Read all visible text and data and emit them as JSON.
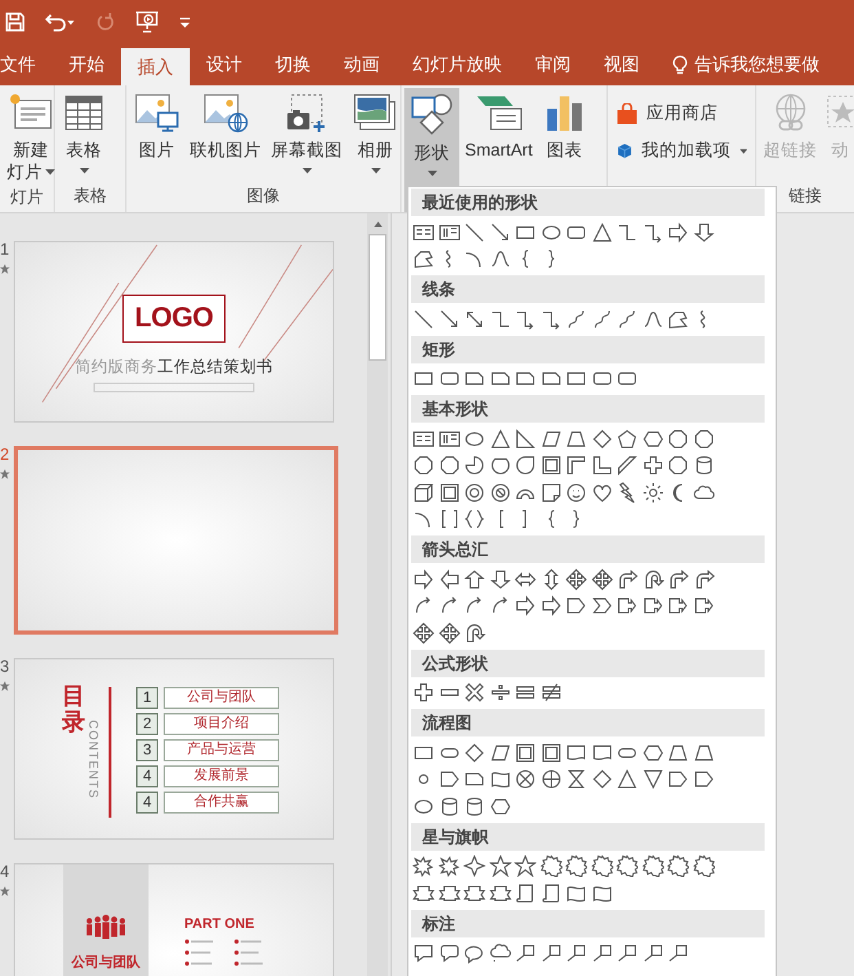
{
  "quick_access": [
    {
      "kind": "save",
      "disabled": false
    },
    {
      "kind": "undo",
      "disabled": false
    },
    {
      "kind": "redo",
      "disabled": true
    },
    {
      "kind": "present",
      "disabled": false
    },
    {
      "kind": "customize",
      "disabled": false
    }
  ],
  "tabs": [
    {
      "label": "文件",
      "selected": false
    },
    {
      "label": "开始",
      "selected": false
    },
    {
      "label": "插入",
      "selected": true
    },
    {
      "label": "设计",
      "selected": false
    },
    {
      "label": "切换",
      "selected": false
    },
    {
      "label": "动画",
      "selected": false
    },
    {
      "label": "幻灯片放映",
      "selected": false
    },
    {
      "label": "审阅",
      "selected": false
    },
    {
      "label": "视图",
      "selected": false
    }
  ],
  "tell_me": "告诉我您想要做",
  "ribbon": {
    "groups": [
      {
        "label": "灯片",
        "buttons": [
          {
            "kind": "new-slide",
            "label": "新建",
            "label_2": "灯片",
            "has_menu": true,
            "pressed": false,
            "disabled": false
          }
        ]
      },
      {
        "label": "表格",
        "buttons": [
          {
            "kind": "table",
            "label": "表格",
            "has_menu": true,
            "pressed": false,
            "disabled": false
          }
        ]
      },
      {
        "label": "图像",
        "buttons": [
          {
            "kind": "picture",
            "label": "图片",
            "has_menu": false,
            "pressed": false,
            "disabled": false
          },
          {
            "kind": "online-picture",
            "label": "联机图片",
            "has_menu": false,
            "pressed": false,
            "disabled": false
          },
          {
            "kind": "screenshot",
            "label": "屏幕截图",
            "has_menu": true,
            "pressed": false,
            "disabled": false
          },
          {
            "kind": "album",
            "label": "相册",
            "has_menu": true,
            "pressed": false,
            "disabled": false
          }
        ]
      },
      {
        "buttons": [
          {
            "kind": "shapes",
            "label": "形状",
            "has_menu": true,
            "pressed": true,
            "disabled": false
          },
          {
            "kind": "smartart",
            "label": "SmartArt",
            "has_menu": false,
            "pressed": false,
            "disabled": false
          },
          {
            "kind": "chart",
            "label": "图表",
            "has_menu": false,
            "pressed": false,
            "disabled": false
          }
        ]
      },
      {
        "buttons": [
          {
            "kind": "store",
            "label": "应用商店",
            "has_menu": false,
            "pressed": false,
            "disabled": false
          },
          {
            "kind": "addins",
            "label": "我的加载项",
            "has_menu": true,
            "pressed": false,
            "disabled": false
          }
        ]
      },
      {
        "label": "链接",
        "buttons": [
          {
            "kind": "hyperlink",
            "label": "超链接",
            "has_menu": false,
            "pressed": false,
            "disabled": true
          },
          {
            "kind": "action",
            "label": "动",
            "has_menu": false,
            "pressed": false,
            "disabled": true
          }
        ]
      }
    ]
  },
  "slides": [
    {
      "number": "1",
      "kind": "title",
      "selected": false,
      "has_animation": true,
      "logo": "LOGO",
      "title_muted": "简约版商务",
      "title": "工作总结策划书"
    },
    {
      "number": "2",
      "kind": "blank",
      "selected": true,
      "has_animation": true
    },
    {
      "number": "3",
      "kind": "contents",
      "selected": false,
      "has_animation": true,
      "heading": "目录",
      "side_text": "CONTENTS",
      "items": [
        {
          "number": "1",
          "label": "公司与团队"
        },
        {
          "number": "2",
          "label": "项目介绍"
        },
        {
          "number": "3",
          "label": "产品与运营"
        },
        {
          "number": "4",
          "label": "发展前景"
        },
        {
          "number": "4",
          "label": "合作共赢"
        }
      ]
    },
    {
      "number": "4",
      "kind": "section",
      "selected": false,
      "has_animation": true,
      "part": "PART ONE",
      "title": "公司与团队"
    }
  ],
  "shapes_menu": {
    "sections": [
      {
        "title": "最近使用的形状"
      },
      {
        "title": "线条"
      },
      {
        "title": "矩形"
      },
      {
        "title": "基本形状"
      },
      {
        "title": "箭头总汇"
      },
      {
        "title": "公式形状"
      },
      {
        "title": "流程图"
      },
      {
        "title": "星与旗帜"
      },
      {
        "title": "标注"
      }
    ]
  }
}
